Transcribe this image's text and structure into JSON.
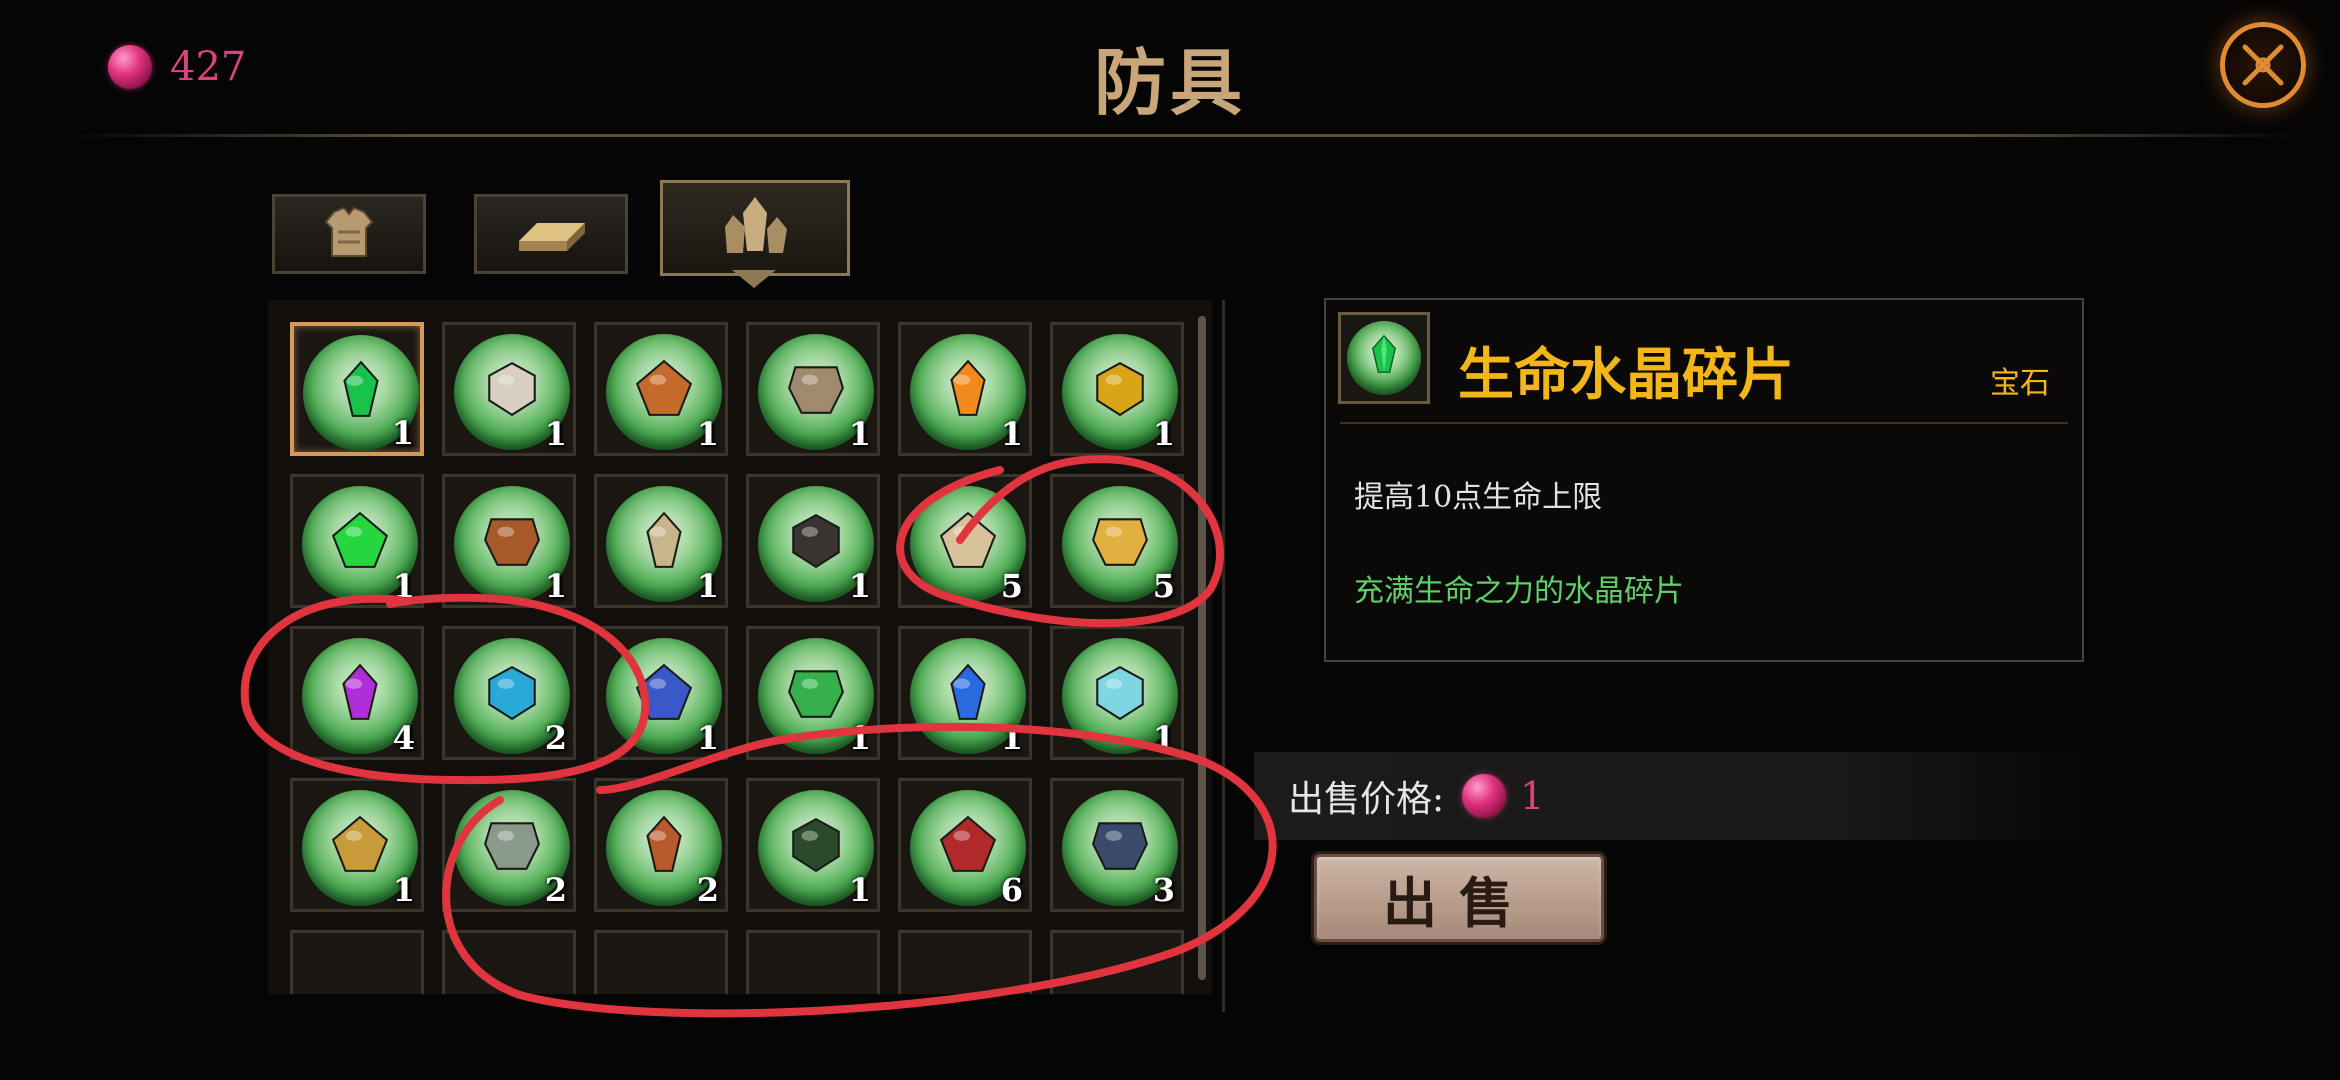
{
  "header": {
    "currency_value": "427",
    "title": "防具",
    "close_icon": "close-icon"
  },
  "tabs": [
    {
      "icon": "chest-armor-icon",
      "active": false
    },
    {
      "icon": "gold-bar-icon",
      "active": false
    },
    {
      "icon": "crystal-cluster-icon",
      "active": true
    }
  ],
  "inventory": {
    "items": [
      {
        "icon": "green-crystal-shard-icon",
        "color": "#19c24a",
        "count": "1",
        "selected": true
      },
      {
        "icon": "bandage-icon",
        "color": "#d8d0c0",
        "count": "1"
      },
      {
        "icon": "hood-icon",
        "color": "#c46a2a",
        "count": "1"
      },
      {
        "icon": "scroll-plate-icon",
        "color": "#a08a6c",
        "count": "1"
      },
      {
        "icon": "orange-star-gem-icon",
        "color": "#f08a1e",
        "count": "1"
      },
      {
        "icon": "gold-black-helm-icon",
        "color": "#d8a418",
        "count": "1"
      },
      {
        "icon": "green-flame-icon",
        "color": "#25d640",
        "count": "1"
      },
      {
        "icon": "bronze-armor-icon",
        "color": "#a8592a",
        "count": "1"
      },
      {
        "icon": "parchment-icon",
        "color": "#c9b58a",
        "count": "1"
      },
      {
        "icon": "dark-amulet-icon",
        "color": "#3a3430",
        "count": "1"
      },
      {
        "icon": "beige-pouch-icon",
        "color": "#d8c29a",
        "count": "5"
      },
      {
        "icon": "golden-ring-icon",
        "color": "#e0b040",
        "count": "5"
      },
      {
        "icon": "purple-rune-icon",
        "color": "#b02ed8",
        "count": "4"
      },
      {
        "icon": "blue-rune-icon",
        "color": "#2aa8d8",
        "count": "2"
      },
      {
        "icon": "blue-gold-charm-icon",
        "color": "#3a58c8",
        "count": "1"
      },
      {
        "icon": "green-gem-icon",
        "color": "#35b04a",
        "count": "1"
      },
      {
        "icon": "blue-shard-icon",
        "color": "#2a6ae0",
        "count": "1"
      },
      {
        "icon": "teal-cloth-icon",
        "color": "#7ed6e0",
        "count": "1"
      },
      {
        "icon": "gold-bow-icon",
        "color": "#c89a3a",
        "count": "1"
      },
      {
        "icon": "grey-bug-icon",
        "color": "#8a9a8a",
        "count": "2"
      },
      {
        "icon": "tribal-mask-icon",
        "color": "#b85a2a",
        "count": "2"
      },
      {
        "icon": "dark-frog-icon",
        "color": "#2a4a2a",
        "count": "1"
      },
      {
        "icon": "red-wing-icon",
        "color": "#b02a2a",
        "count": "6"
      },
      {
        "icon": "steel-helm-icon",
        "color": "#3a4a6a",
        "count": "3"
      },
      {
        "icon": "",
        "color": "",
        "count": ""
      },
      {
        "icon": "",
        "color": "",
        "count": ""
      },
      {
        "icon": "",
        "color": "",
        "count": ""
      },
      {
        "icon": "",
        "color": "",
        "count": ""
      },
      {
        "icon": "",
        "color": "",
        "count": ""
      },
      {
        "icon": "",
        "color": "",
        "count": ""
      }
    ]
  },
  "detail": {
    "icon": "green-crystal-shard-icon",
    "name": "生命水晶碎片",
    "type": "宝石",
    "effect": "提高10点生命上限",
    "description": "充满生命之力的水晶碎片"
  },
  "sell": {
    "price_label": "出售价格:",
    "price_value": "1",
    "button_label": "出售"
  },
  "colors": {
    "title": "#c9a679",
    "currency": "#d9447f",
    "item_name": "#f2b619",
    "description": "#5fcf6a",
    "annotation": "#e0343f"
  }
}
